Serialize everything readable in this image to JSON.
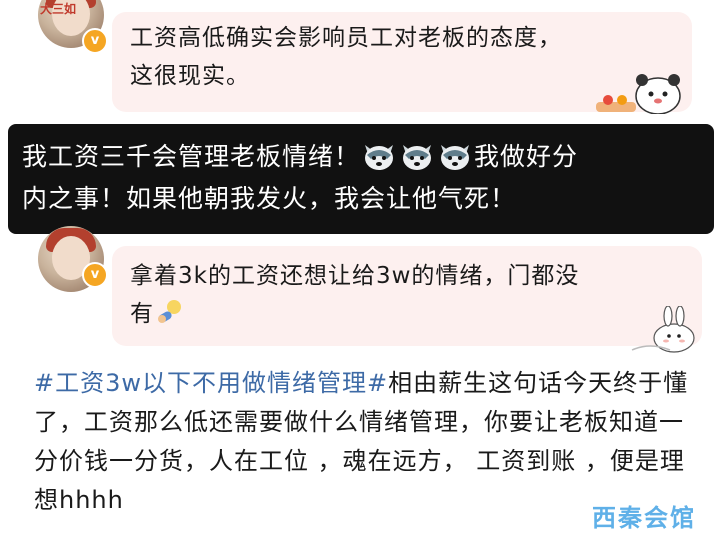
{
  "comments": [
    {
      "text": "工资高低确实会影响员工对老板的态度，这很现实。",
      "line1": "工资高低确实会影响员工对老板的态度，",
      "line2": "这很现实。",
      "avatar_text": "大三如"
    },
    {
      "line1": "拿着3k的工资还想让给3w的情绪，门都没",
      "line2": "有"
    }
  ],
  "overlay": {
    "line1_a": "我工资三千会管理老板情绪！",
    "line1_b": "我做好分",
    "line2": "内之事！如果他朝我发火，我会让他气死！",
    "emoji": "husky-icon"
  },
  "post": {
    "hashtag": "#工资3w以下不用做情绪管理#",
    "body": "相由薪生这句话今天终于懂了，工资那么低还需要做什么情绪管理，你要让老板知道一分价钱一分货，人在工位 ，魂在远方， 工资到账 ，便是理想hhhh"
  },
  "watermark": "西秦会馆",
  "colors": {
    "card_bg": "#fdf0ef",
    "hashtag": "#3d6aa6",
    "badge": "#f5a623",
    "overlay_bg": "#111111",
    "watermark": "#5fb0e8"
  }
}
